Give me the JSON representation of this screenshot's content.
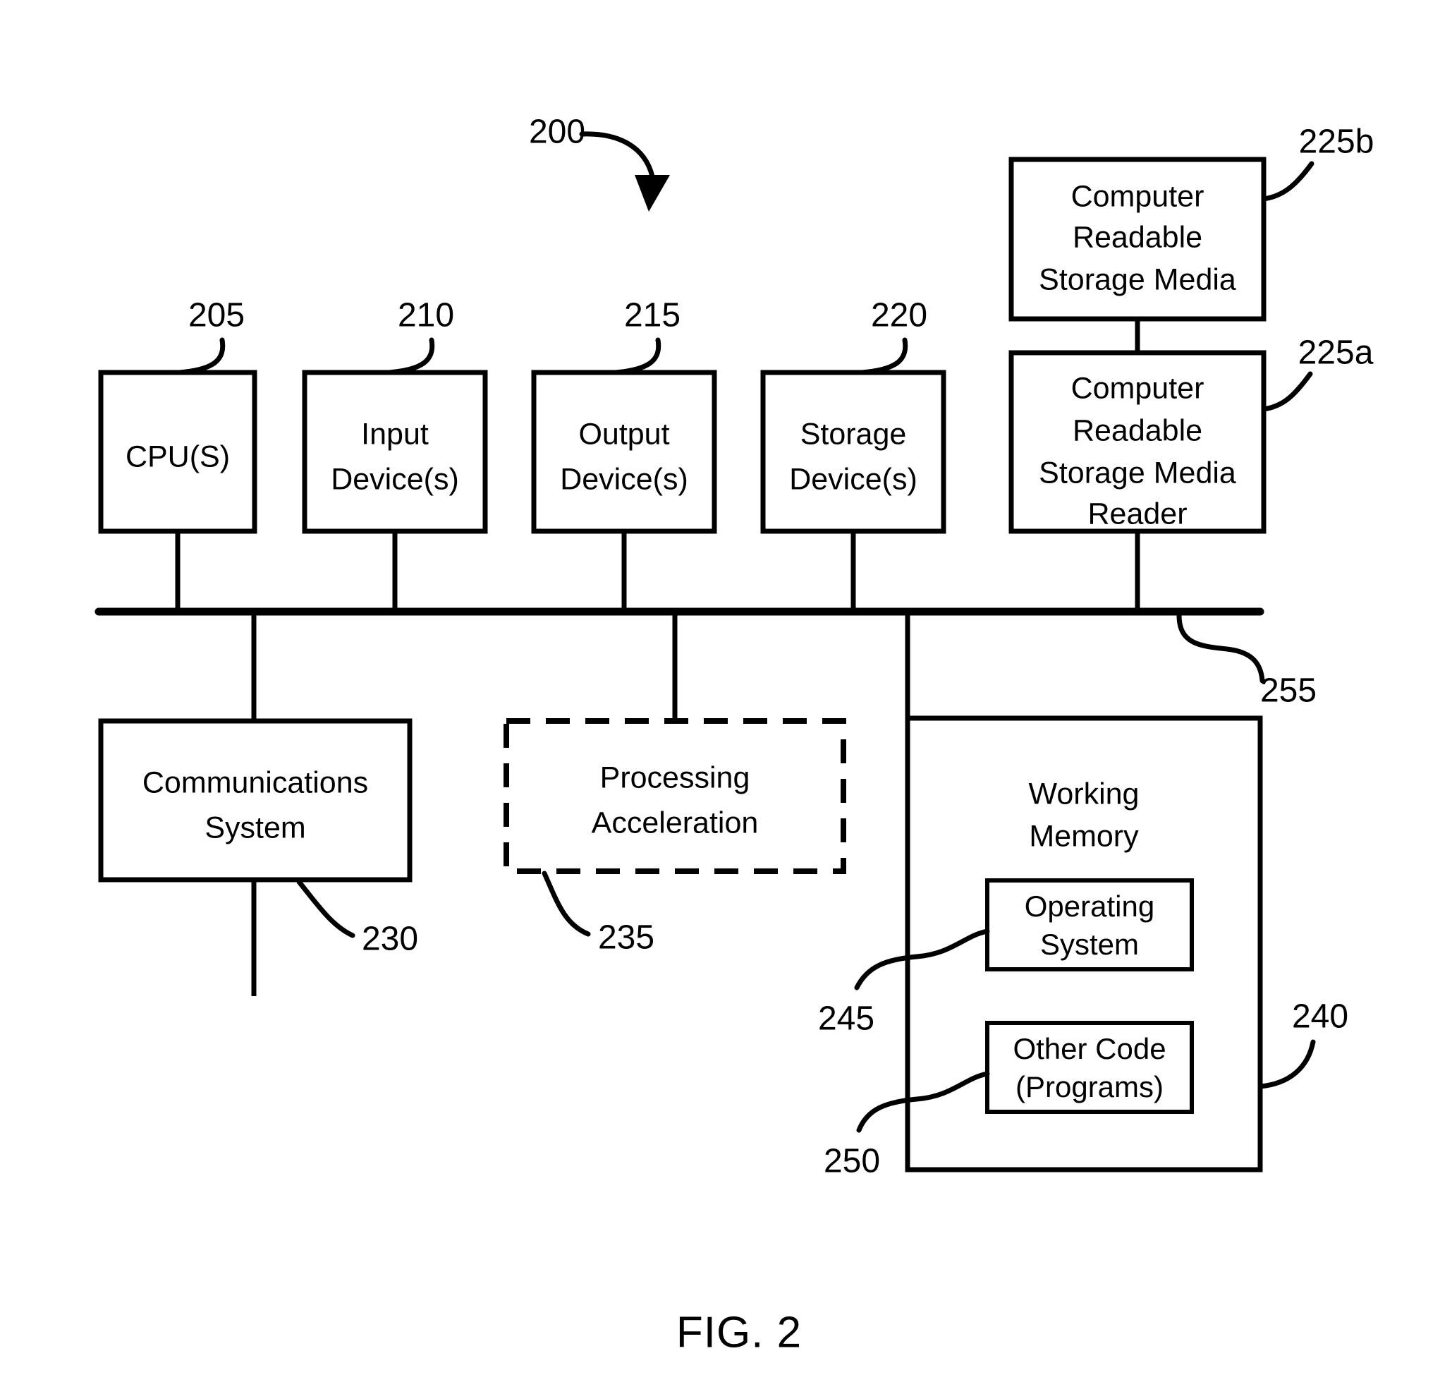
{
  "figure": {
    "caption": "FIG. 2",
    "system_ref": "200"
  },
  "blocks": [
    {
      "id": "cpu",
      "lines": [
        "CPU(S)"
      ],
      "ref": "205",
      "style": "solid"
    },
    {
      "id": "input-devices",
      "lines": [
        "Input",
        "Device(s)"
      ],
      "ref": "210",
      "style": "solid"
    },
    {
      "id": "output-devices",
      "lines": [
        "Output",
        "Device(s)"
      ],
      "ref": "215",
      "style": "solid"
    },
    {
      "id": "storage-devices",
      "lines": [
        "Storage",
        "Device(s)"
      ],
      "ref": "220",
      "style": "solid"
    },
    {
      "id": "crsm",
      "lines": [
        "Computer",
        "Readable",
        "Storage Media"
      ],
      "ref": "225b",
      "style": "solid"
    },
    {
      "id": "crsm-reader",
      "lines": [
        "Computer",
        "Readable",
        "Storage Media",
        "Reader"
      ],
      "ref": "225a",
      "style": "solid"
    },
    {
      "id": "comm-system",
      "lines": [
        "Communications",
        "System"
      ],
      "ref": "230",
      "style": "solid"
    },
    {
      "id": "proc-accel",
      "lines": [
        "Processing",
        "Acceleration"
      ],
      "ref": "235",
      "style": "dashed"
    },
    {
      "id": "working-memory",
      "lines": [
        "Working",
        "Memory"
      ],
      "ref": "240",
      "style": "solid"
    },
    {
      "id": "operating-system",
      "lines": [
        "Operating",
        "System"
      ],
      "ref": "245",
      "style": "solid"
    },
    {
      "id": "other-code",
      "lines": [
        "Other Code",
        "(Programs)"
      ],
      "ref": "250",
      "style": "solid"
    }
  ],
  "bus": {
    "ref": "255"
  },
  "text": {
    "cpu_l1": "CPU(S)",
    "input_l1": "Input",
    "input_l2": "Device(s)",
    "output_l1": "Output",
    "output_l2": "Device(s)",
    "storage_l1": "Storage",
    "storage_l2": "Device(s)",
    "crsm_l1": "Computer",
    "crsm_l2": "Readable",
    "crsm_l3": "Storage Media",
    "reader_l1": "Computer",
    "reader_l2": "Readable",
    "reader_l3": "Storage Media",
    "reader_l4": "Reader",
    "comm_l1": "Communications",
    "comm_l2": "System",
    "accel_l1": "Processing",
    "accel_l2": "Acceleration",
    "wm_l1": "Working",
    "wm_l2": "Memory",
    "os_l1": "Operating",
    "os_l2": "System",
    "code_l1": "Other Code",
    "code_l2": "(Programs)"
  },
  "refs": {
    "system": "200",
    "cpu": "205",
    "input": "210",
    "output": "215",
    "storage": "220",
    "crsm": "225b",
    "reader": "225a",
    "comm": "230",
    "accel": "235",
    "wm": "240",
    "os": "245",
    "code": "250",
    "bus": "255"
  },
  "colors": {
    "stroke": "#000000",
    "background": "#ffffff"
  }
}
